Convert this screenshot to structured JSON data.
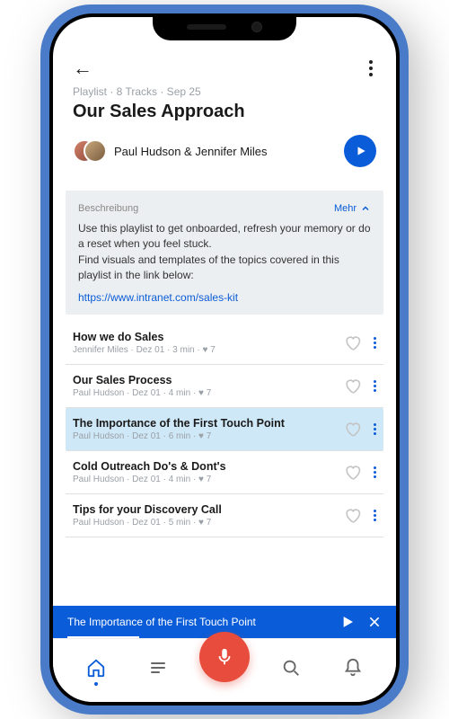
{
  "header": {
    "meta": "Playlist · 8 Tracks · Sep 25",
    "title": "Our Sales Approach",
    "authors": "Paul Hudson & Jennifer Miles"
  },
  "description": {
    "label": "Beschreibung",
    "toggle": "Mehr",
    "body": "Use this playlist to get onboarded, refresh your memory or do a reset when you feel stuck.\nFind visuals and templates of the topics covered in this playlist in the link below:",
    "link": "https://www.intranet.com/sales-kit"
  },
  "tracks": [
    {
      "title": "How we do Sales",
      "meta": "Jennifer Miles · Dez 01 · 3 min · ♥ 7",
      "active": false
    },
    {
      "title": "Our Sales Process",
      "meta": "Paul Hudson · Dez 01 · 4 min · ♥ 7",
      "active": false
    },
    {
      "title": "The Importance of the First Touch Point",
      "meta": "Paul Hudson · Dez 01 · 6 min · ♥ 7",
      "active": true
    },
    {
      "title": "Cold Outreach Do's & Dont's",
      "meta": "Paul Hudson · Dez 01 · 4 min · ♥ 7",
      "active": false
    },
    {
      "title": "Tips for your Discovery Call",
      "meta": "Paul Hudson · Dez 01 · 5 min · ♥ 7",
      "active": false
    }
  ],
  "player": {
    "now_playing": "The Importance of the First Touch Point"
  }
}
